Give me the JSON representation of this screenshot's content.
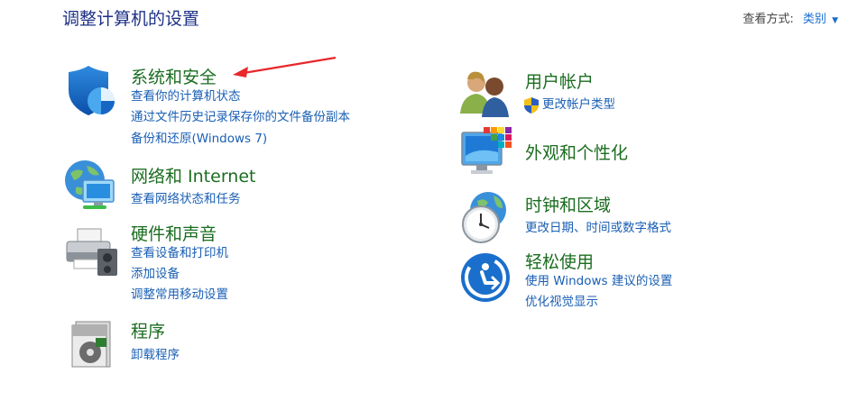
{
  "header": {
    "title": "调整计算机的设置",
    "view_by_label": "查看方式:",
    "view_by_value": "类别"
  },
  "categories": [
    {
      "icon": "shield-icon",
      "title": "系统和安全",
      "links": [
        "查看你的计算机状态",
        "通过文件历史记录保存你的文件备份副本",
        "备份和还原(Windows 7)"
      ]
    },
    {
      "icon": "network-icon",
      "title": "网络和 Internet",
      "links": [
        "查看网络状态和任务"
      ]
    },
    {
      "icon": "printer-icon",
      "title": "硬件和声音",
      "links": [
        "查看设备和打印机",
        "添加设备",
        "调整常用移动设置"
      ]
    },
    {
      "icon": "programs-icon",
      "title": "程序",
      "links": [
        "卸载程序"
      ]
    },
    {
      "icon": "users-icon",
      "title": "用户帐户",
      "links": [
        "更改帐户类型"
      ],
      "link_icons": [
        "uac-shield-icon"
      ]
    },
    {
      "icon": "appearance-icon",
      "title": "外观和个性化",
      "links": []
    },
    {
      "icon": "clock-globe-icon",
      "title": "时钟和区域",
      "links": [
        "更改日期、时间或数字格式"
      ]
    },
    {
      "icon": "ease-of-access-icon",
      "title": "轻松使用",
      "links": [
        "使用 Windows 建议的设置",
        "优化视觉显示"
      ]
    }
  ],
  "colors": {
    "title": "#1e3287",
    "category_title": "#1b6d20",
    "link": "#1a5fb4",
    "annotation_arrow": "#e8282b"
  }
}
